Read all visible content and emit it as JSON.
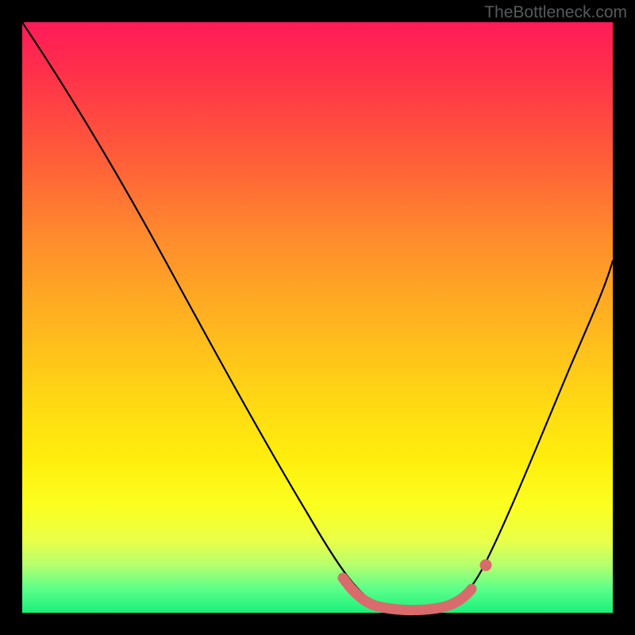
{
  "watermark": "TheBottleneck.com",
  "colors": {
    "frame": "#000000",
    "curve": "#000000",
    "marker": "#d96b6c",
    "gradient_stops": [
      "#ff1a58",
      "#ff2f4b",
      "#ff5a3a",
      "#ff8a2e",
      "#ffb220",
      "#ffd814",
      "#ffee0d",
      "#fbff20",
      "#e8ff4a",
      "#b4ff70",
      "#5bff8a",
      "#18f07a"
    ]
  },
  "chart_data": {
    "type": "line",
    "title": "",
    "xlabel": "",
    "ylabel": "",
    "xlim": [
      0,
      100
    ],
    "ylim": [
      0,
      100
    ],
    "series": [
      {
        "name": "bottleneck-curve",
        "x": [
          0,
          5,
          10,
          15,
          20,
          25,
          30,
          35,
          40,
          45,
          50,
          53,
          56,
          59,
          62,
          65,
          68,
          71,
          74,
          76,
          80,
          84,
          88,
          92,
          96,
          100
        ],
        "values": [
          100,
          93,
          86,
          79,
          72,
          64,
          56,
          48,
          40,
          32,
          23,
          17,
          11,
          6,
          3,
          1,
          1,
          1,
          2,
          5,
          12,
          21,
          31,
          41,
          51,
          61
        ]
      }
    ],
    "markers": [
      {
        "name": "flat-minimum",
        "x_range": [
          56,
          74
        ],
        "y": 2
      },
      {
        "name": "elbow-right",
        "x": 76,
        "y": 5
      }
    ]
  }
}
